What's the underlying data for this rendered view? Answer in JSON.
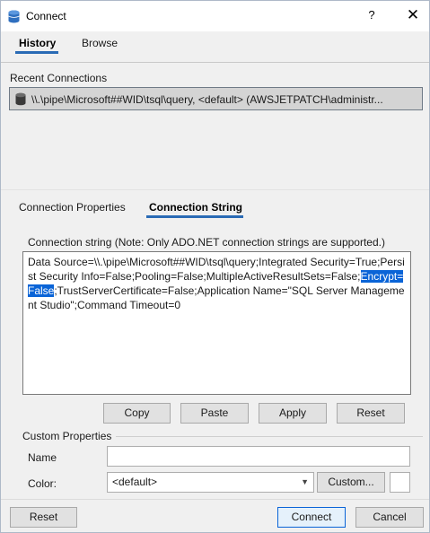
{
  "window": {
    "title": "Connect",
    "help": "?",
    "close": "✕"
  },
  "top_tabs": [
    {
      "label": "History",
      "active": true
    },
    {
      "label": "Browse",
      "active": false
    }
  ],
  "recent": {
    "label": "Recent Connections",
    "items": [
      {
        "text": "\\\\.\\pipe\\Microsoft##WID\\tsql\\query, <default> (AWSJETPATCH\\administr..."
      }
    ]
  },
  "lower_tabs": [
    {
      "label": "Connection Properties",
      "active": false
    },
    {
      "label": "Connection String",
      "active": true
    }
  ],
  "connection_string": {
    "note": "Connection string (Note: Only ADO.NET connection strings are supported.)",
    "before_selection": "Data Source=\\\\.\\pipe\\Microsoft##WID\\tsql\\query;Integrated Security=True;Persist Security Info=False;Pooling=False;MultipleActiveResultSets=False;",
    "selected": "Encrypt=False",
    "after_selection": ";TrustServerCertificate=False;Application Name=\"SQL Server Management Studio\";Command Timeout=0"
  },
  "string_buttons": {
    "copy": "Copy",
    "paste": "Paste",
    "apply": "Apply",
    "reset": "Reset"
  },
  "custom_properties": {
    "label": "Custom Properties",
    "name_label": "Name",
    "name_value": "",
    "color_label": "Color:",
    "color_value": "<default>",
    "custom_button": "Custom..."
  },
  "footer": {
    "reset": "Reset",
    "connect": "Connect",
    "cancel": "Cancel"
  },
  "colors": {
    "accent": "#2a6bb5",
    "selection": "#0a64d7",
    "recent_row_bg": "#d4d4d4"
  },
  "icons": {
    "app": "database-icon",
    "recent": "database-icon",
    "dropdown": "chevron-down-icon"
  }
}
